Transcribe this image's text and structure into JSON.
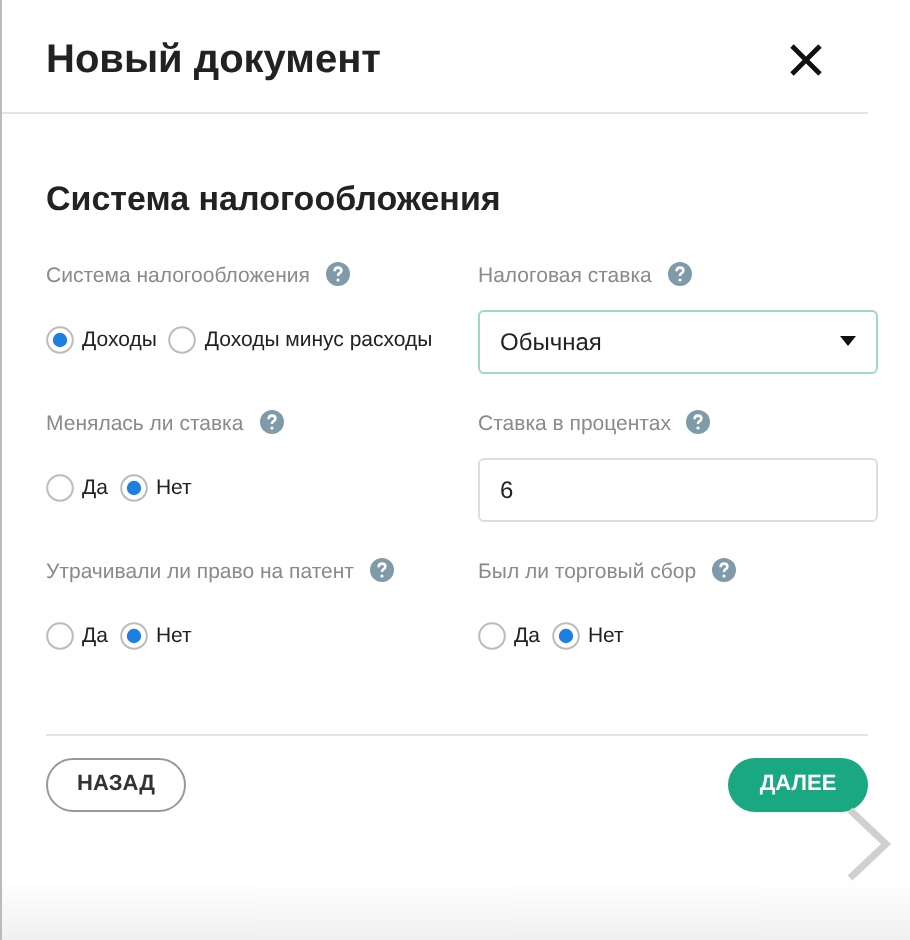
{
  "dialog": {
    "title": "Новый документ"
  },
  "section": {
    "title": "Система налогообложения"
  },
  "fields": [
    {
      "kind": "radio",
      "label": "Система налогообложения",
      "options": [
        {
          "label": "Доходы",
          "selected": true
        },
        {
          "label": "Доходы минус расходы",
          "selected": false
        }
      ]
    },
    {
      "kind": "select",
      "label": "Налоговая ставка",
      "value": "Обычная"
    },
    {
      "kind": "radio",
      "label": "Менялась ли ставка",
      "options": [
        {
          "label": "Да",
          "selected": false
        },
        {
          "label": "Нет",
          "selected": true
        }
      ]
    },
    {
      "kind": "text",
      "label": "Ставка в процентах",
      "value": "6"
    },
    {
      "kind": "radio",
      "label": "Утрачивали ли право на патент",
      "options": [
        {
          "label": "Да",
          "selected": false
        },
        {
          "label": "Нет",
          "selected": true
        }
      ]
    },
    {
      "kind": "radio",
      "label": "Был ли торговый сбор",
      "options": [
        {
          "label": "Да",
          "selected": false
        },
        {
          "label": "Нет",
          "selected": true
        }
      ]
    }
  ],
  "buttons": {
    "back": "НАЗАД",
    "next": "ДАЛЕЕ"
  }
}
